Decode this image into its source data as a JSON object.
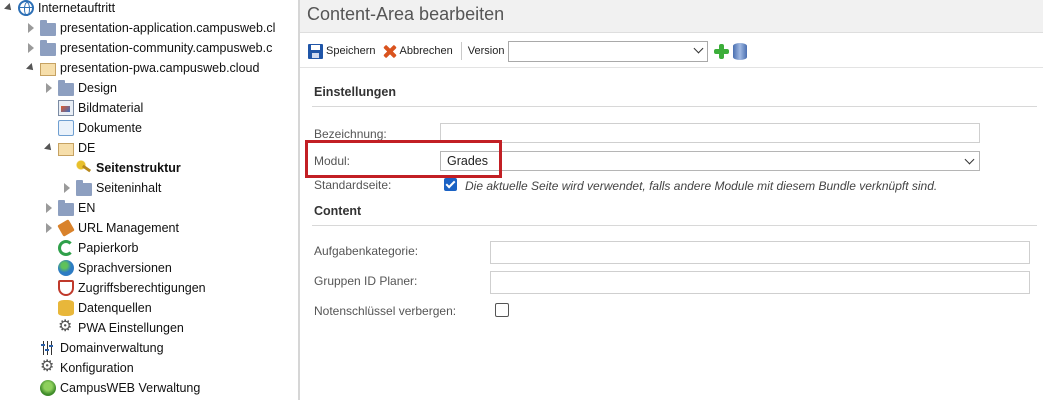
{
  "sidebar": {
    "items": [
      {
        "label": "Internetauftritt",
        "icon": "globe-icon",
        "expanded": true
      },
      {
        "label": "presentation-application.campusweb.cl",
        "icon": "folder-icon"
      },
      {
        "label": "presentation-community.campusweb.c",
        "icon": "folder-icon"
      },
      {
        "label": "presentation-pwa.campusweb.cloud",
        "icon": "folder-open-icon",
        "expanded": true
      },
      {
        "label": "Design",
        "icon": "folder-icon"
      },
      {
        "label": "Bildmaterial",
        "icon": "image-icon"
      },
      {
        "label": "Dokumente",
        "icon": "documents-icon"
      },
      {
        "label": "DE",
        "icon": "folder-open-icon",
        "expanded": true
      },
      {
        "label": "Seitenstruktur",
        "icon": "key-icon",
        "selected": true
      },
      {
        "label": "Seiteninhalt",
        "icon": "folder-icon"
      },
      {
        "label": "EN",
        "icon": "folder-icon"
      },
      {
        "label": "URL Management",
        "icon": "tag-icon"
      },
      {
        "label": "Papierkorb",
        "icon": "recycle-icon"
      },
      {
        "label": "Sprachversionen",
        "icon": "earth-icon"
      },
      {
        "label": "Zugriffsberechtigungen",
        "icon": "shield-icon"
      },
      {
        "label": "Datenquellen",
        "icon": "database-icon"
      },
      {
        "label": "PWA Einstellungen",
        "icon": "gear-icon"
      },
      {
        "label": "Domainverwaltung",
        "icon": "sliders-icon"
      },
      {
        "label": "Konfiguration",
        "icon": "gear-icon"
      },
      {
        "label": "CampusWEB Verwaltung",
        "icon": "campus-icon"
      }
    ]
  },
  "main": {
    "title": "Content-Area bearbeiten",
    "toolbar": {
      "save_label": "Speichern",
      "cancel_label": "Abbrechen",
      "version_label": "Version",
      "version_value": ""
    },
    "settings": {
      "heading": "Einstellungen",
      "bezeichnung_label": "Bezeichnung:",
      "bezeichnung_value": "",
      "modul_label": "Modul:",
      "modul_value": "Grades",
      "standardseite_label": "Standardseite:",
      "standardseite_checked": true,
      "standardseite_hint": "Die aktuelle Seite wird verwendet, falls andere Module mit diesem Bundle verknüpft sind."
    },
    "content": {
      "heading": "Content",
      "aufgabenkategorie_label": "Aufgabenkategorie:",
      "aufgabenkategorie_value": "",
      "gruppen_label": "Gruppen ID Planer:",
      "gruppen_value": "",
      "notenschluessel_label": "Notenschlüssel verbergen:",
      "notenschluessel_checked": false
    }
  },
  "colors": {
    "highlight": "#c21f24",
    "checkbox_accent": "#1a62c4",
    "folder": "#8d9fc0"
  }
}
